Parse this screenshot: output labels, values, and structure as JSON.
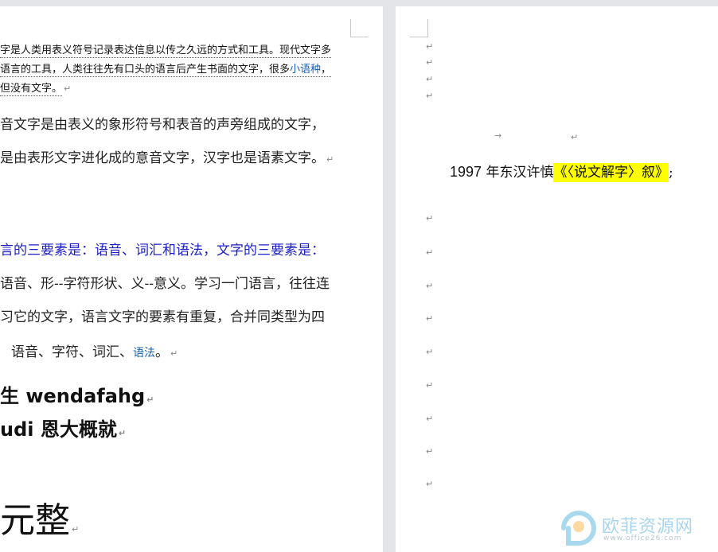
{
  "left_page": {
    "small_paragraph": [
      "字是人类用表义符号记录表达信息以传之久远的方式和工具。现代文字多",
      "语言的工具，人类往往先有口头的语言后产生书面的文字，很多",
      "但没有文字。"
    ],
    "small_link": "小语种",
    "small_tail": "，",
    "paragraph_2": [
      "音文字是由表义的象形符号和表音的声旁组成的文字，",
      "是由表形文字进化成的意音文字，汉字也是语素文字。"
    ],
    "paragraph_3_blue": "言的三要素是：语音、词汇和语法，文字的三要素是：",
    "paragraph_3": [
      "语音、形--字符形状、义--意义。学习一门语言，往往连",
      "习它的文字，语言文字的要素有重复，合并同类型为四"
    ],
    "paragraph_3_last": "语音、字符、词汇、",
    "paragraph_3_link": "语法",
    "paragraph_3_end": "。",
    "bold_line_1": "生 wendafahg",
    "bold_line_2": "udi 恩大概就",
    "huge_line": "元整",
    "para_mark": "↵"
  },
  "right_page": {
    "empty_marks": [
      "↵",
      "↵",
      "↵",
      "↵"
    ],
    "arrow_mark": "→",
    "after_arrow": "↵",
    "title_year": "1997",
    "title_text": " 年东汉许慎",
    "title_highlight": "《〈说文解字〉叙》",
    "title_end": ";",
    "lower_marks": [
      "↵",
      "↵",
      "↵",
      "↵",
      "↵",
      "↵",
      "↵",
      "↵",
      "↵"
    ],
    "highlight_color": "#ffff00"
  },
  "watermark": {
    "name": "欧菲资源网",
    "url": "www.office26.com"
  }
}
